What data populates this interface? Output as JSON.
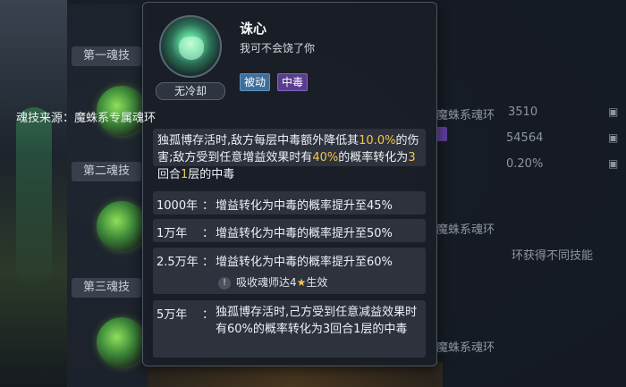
{
  "background": {
    "sections": [
      "第一魂技",
      "第二魂技",
      "第三魂技"
    ],
    "right_items": [
      "魔蛛系魂环",
      "魔蛛系魂环",
      "魔蛛系魂环"
    ],
    "right_values": [
      "3510",
      "54564",
      "0.20%"
    ],
    "right_note": "环获得不同技能"
  },
  "popup": {
    "skill_name": "诛心",
    "quote": "我可不会饶了你",
    "cooldown": "无冷却",
    "tags": [
      "被动",
      "中毒"
    ],
    "source_label": "魂技来源：",
    "source_value": "魔蛛系专属魂环",
    "description": {
      "p1": "独孤博存活时,敌方每层中毒额外降低其",
      "v1": "10.0%",
      "p2": "的伤害;敌方受到任意增益效果时有",
      "v2": "40%",
      "p3": "的概率转化为",
      "v3": "3",
      "p4": "回合",
      "v4": "1",
      "p5": "层的中毒"
    },
    "levels": [
      {
        "label": "1000年",
        "sep": "：",
        "text": "增益转化为中毒的概率提升至45%"
      },
      {
        "label": "1万年",
        "sep": "：",
        "text": "增益转化为中毒的概率提升至50%"
      },
      {
        "label": "2.5万年",
        "sep": "：",
        "text": "增益转化为中毒的概率提升至60%"
      }
    ],
    "condition": {
      "icon": "warning-icon",
      "text_before": "吸收魂师达4",
      "star": "★",
      "text_after": "生效"
    },
    "final_level": {
      "label": "5万年",
      "sep": "：",
      "text": "独孤博存活时,己方受到任意减益效果时有60%的概率转化为3回合1层的中毒"
    }
  },
  "colors": {
    "highlight": "#f3c74a",
    "passive_tag": "#3e6f9a",
    "poison_tag": "#5a3e8e"
  }
}
